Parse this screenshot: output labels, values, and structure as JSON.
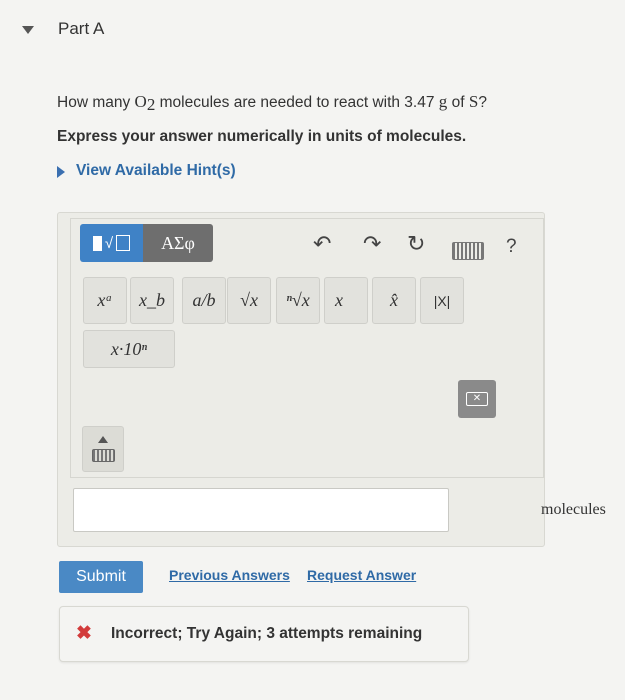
{
  "part": {
    "title": "Part A"
  },
  "question": {
    "prefix": "How many ",
    "molecule": "O",
    "molecule_sub": "2",
    "middle": " molecules are needed to react with 3.47 ",
    "unit": "g",
    "suffix": " of ",
    "element": "S",
    "end": "?"
  },
  "instructions": "Express your answer numerically in units of molecules.",
  "hints": {
    "label": "View Available Hint(s)"
  },
  "toolbar": {
    "greek_label": "ΑΣφ",
    "undo": "↶",
    "redo": "↷",
    "reset": "↻",
    "help": "?"
  },
  "math_buttons": [
    "xᵃ",
    "x_b",
    "a/b",
    "√x",
    "ⁿ√x",
    "x⃗",
    "x̂",
    "|X|"
  ],
  "sci_button": "x·10ⁿ",
  "answer": {
    "value": "",
    "units": "molecules"
  },
  "actions": {
    "submit": "Submit",
    "previous": "Previous Answers",
    "request": "Request Answer"
  },
  "feedback": {
    "icon": "✖",
    "text": "Incorrect; Try Again; 3 attempts remaining"
  },
  "colors": {
    "accent": "#4a89c5",
    "link": "#2f6aa6",
    "error": "#d23b3b"
  }
}
